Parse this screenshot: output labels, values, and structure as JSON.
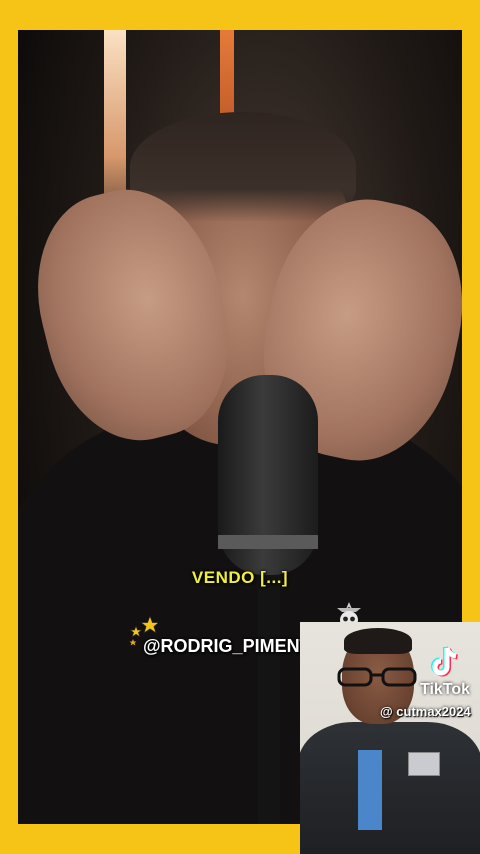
{
  "video": {
    "caption": "VENDO [...]",
    "creator_handle": "@RODRIG_PIMENTEL"
  },
  "watermark": {
    "brand": "TikTok",
    "username": "@ cutmax2024",
    "logo_icon": "tiktok-note-icon"
  },
  "colors": {
    "frame": "#f5c417",
    "caption": "#f1ef3c",
    "handle": "#ffffff"
  }
}
